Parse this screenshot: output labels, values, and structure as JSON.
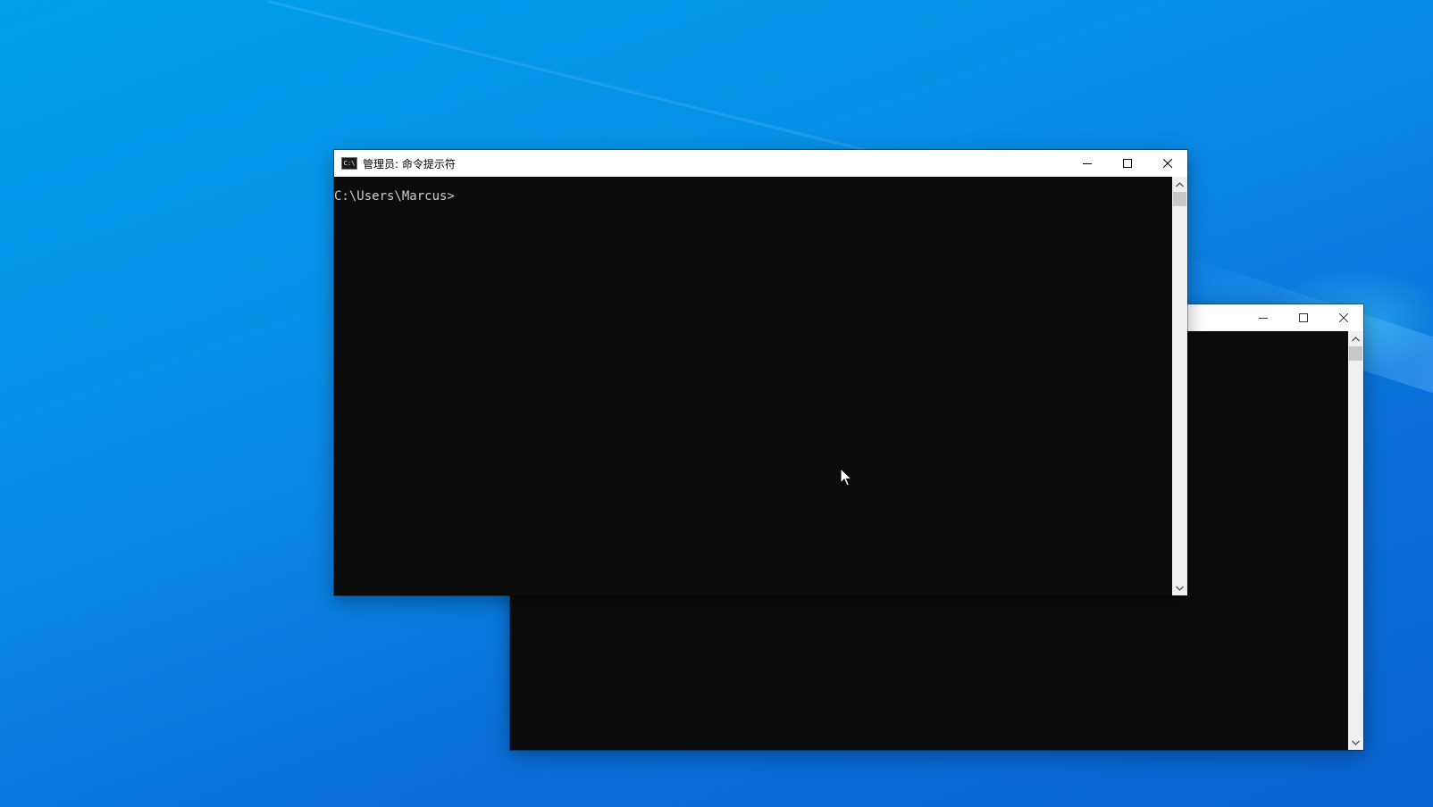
{
  "desktop": {
    "wallpaper_colors": [
      "#00a0ee",
      "#0890e8",
      "#0a6fd8",
      "#0a63cf"
    ]
  },
  "front_window": {
    "title": "管理员: 命令提示符",
    "icon_label": "C:\\",
    "console_text": "C:\\Users\\Marcus>",
    "console_bg": "#0c0c0c",
    "console_fg": "#cccccc",
    "caption_icons": [
      "minimize-icon",
      "maximize-icon",
      "close-icon"
    ]
  },
  "back_window": {
    "title": "",
    "console_text": "",
    "caption_icons": [
      "minimize-icon",
      "maximize-icon",
      "close-icon"
    ]
  },
  "cursor": {
    "icon": "arrow-cursor-icon"
  }
}
